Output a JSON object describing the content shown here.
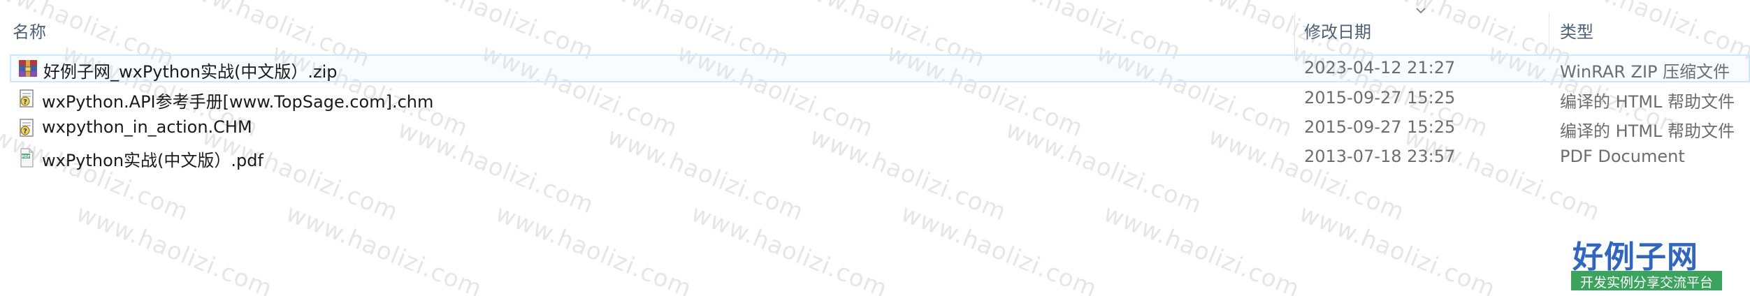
{
  "header": {
    "col_name": "名称",
    "col_date": "修改日期",
    "col_type": "类型"
  },
  "watermark": "www.haolizi.com",
  "files": [
    {
      "name": "好例子网_wxPython实战(中文版）.zip",
      "date": "2023-04-12 21:27",
      "type": "WinRAR ZIP 压缩文件",
      "icon": "winrar-zip-icon",
      "selected": true
    },
    {
      "name": "wxPython.API参考手册[www.TopSage.com].chm",
      "date": "2015-09-27 15:25",
      "type": "编译的 HTML 帮助文件",
      "icon": "chm-help-icon",
      "selected": false
    },
    {
      "name": "wxpython_in_action.CHM",
      "date": "2015-09-27 15:25",
      "type": "编译的 HTML 帮助文件",
      "icon": "chm-help-icon",
      "selected": false
    },
    {
      "name": "wxPython实战(中文版）.pdf",
      "date": "2013-07-18 23:57",
      "type": "PDF Document",
      "icon": "pdf-file-icon",
      "selected": false
    }
  ],
  "logo": {
    "main": "好例子网",
    "sub": "开发实例分享交流平台"
  },
  "colors": {
    "header_text": "#4c607a",
    "selection_border": "#cce8ff",
    "logo_blue": "#2e66c7",
    "logo_green": "#3aa35c"
  }
}
